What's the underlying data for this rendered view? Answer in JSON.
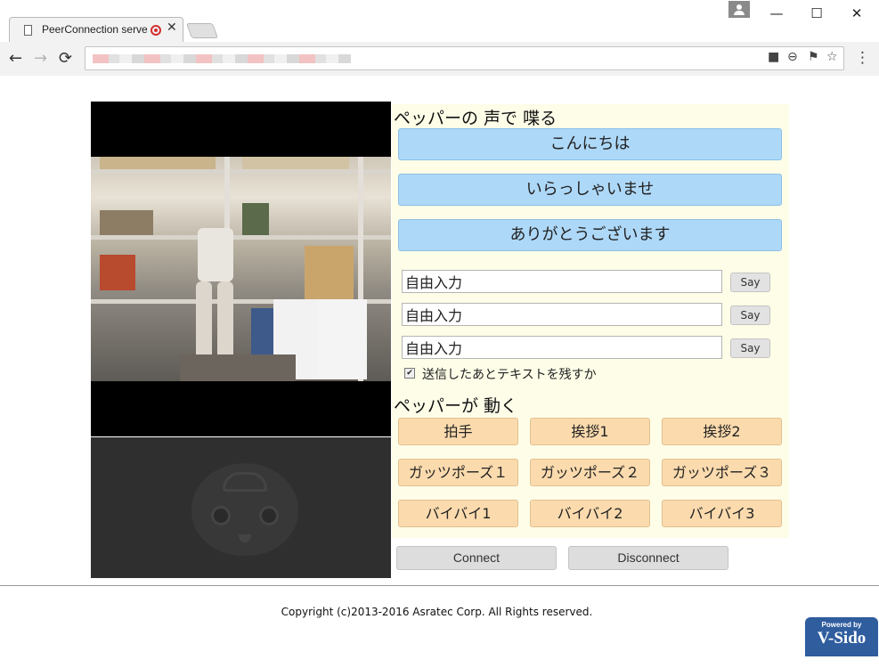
{
  "browser": {
    "tab_title": "PeerConnection serve",
    "tab_close": "✕",
    "window_controls": {
      "minimize": "—",
      "maximize": "☐",
      "close": "✕"
    },
    "nav": {
      "back": "←",
      "forward": "→",
      "reload": "⟳"
    },
    "omnibox_icons": {
      "camera": "■",
      "zoom": "⊖",
      "extension": "⚑",
      "star": "☆"
    },
    "menu": "⋮"
  },
  "speak_section": {
    "title": "ペッパーの 声で 喋る",
    "phrases": [
      "こんにちは",
      "いらっしゃいませ",
      "ありがとうございます"
    ],
    "inputs": [
      {
        "value": "自由入力",
        "say_label": "Say"
      },
      {
        "value": "自由入力",
        "say_label": "Say"
      },
      {
        "value": "自由入力",
        "say_label": "Say"
      }
    ],
    "keep_text_checked": true,
    "keep_text_mark": "✔",
    "keep_text_label": "送信したあとテキストを残すか"
  },
  "move_section": {
    "title": "ペッパーが 動く",
    "buttons": [
      [
        "拍手",
        "挨拶1",
        "挨拶2"
      ],
      [
        "ガッツポーズ１",
        "ガッツポーズ２",
        "ガッツポーズ３"
      ],
      [
        "バイバイ1",
        "バイバイ2",
        "バイバイ3"
      ]
    ]
  },
  "connection": {
    "connect_label": "Connect",
    "disconnect_label": "Disconnect"
  },
  "footer": {
    "copyright": "Copyright (c)2013-2016 Asratec Corp. All Rights reserved.",
    "badge_powered": "Powered by",
    "badge_brand": "V-Sido"
  },
  "colors": {
    "speak_button": "#aed8f8",
    "move_button": "#fbdbae",
    "panel_bg": "#fdfde8",
    "badge": "#2f5d9e"
  }
}
